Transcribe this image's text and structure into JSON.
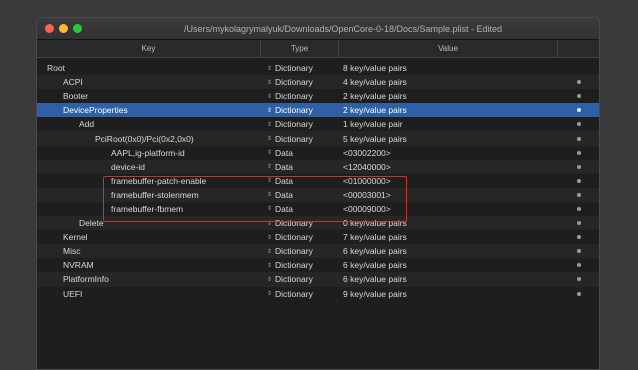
{
  "window": {
    "title": "/Users/mykolagrymalyuk/Downloads/OpenCore-0-18/Docs/Sample.plist - Edited"
  },
  "columns": {
    "key": "Key",
    "type": "Type",
    "value": "Value"
  },
  "rows": [
    {
      "key": "Root",
      "type": "Dictionary",
      "value": "8 key/value pairs"
    },
    {
      "key": "ACPI",
      "type": "Dictionary",
      "value": "4 key/value pairs"
    },
    {
      "key": "Booter",
      "type": "Dictionary",
      "value": "2 key/value pairs"
    },
    {
      "key": "DeviceProperties",
      "type": "Dictionary",
      "value": "2 key/value pairs"
    },
    {
      "key": "Add",
      "type": "Dictionary",
      "value": "1 key/value pair"
    },
    {
      "key": "PciRoot(0x0)/Pci(0x2,0x0)",
      "type": "Dictionary",
      "value": "5 key/value pairs"
    },
    {
      "key": "AAPL,ig-platform-id",
      "type": "Data",
      "value": "<03002200>"
    },
    {
      "key": "device-id",
      "type": "Data",
      "value": "<12040000>"
    },
    {
      "key": "framebuffer-patch-enable",
      "type": "Data",
      "value": "<01000000>"
    },
    {
      "key": "framebuffer-stolenmem",
      "type": "Data",
      "value": "<00003001>"
    },
    {
      "key": "framebuffer-fbmem",
      "type": "Data",
      "value": "<00009000>"
    },
    {
      "key": "Delete",
      "type": "Dictionary",
      "value": "0 key/value pairs"
    },
    {
      "key": "Kernel",
      "type": "Dictionary",
      "value": "7 key/value pairs"
    },
    {
      "key": "Misc",
      "type": "Dictionary",
      "value": "6 key/value pairs"
    },
    {
      "key": "NVRAM",
      "type": "Dictionary",
      "value": "6 key/value pairs"
    },
    {
      "key": "PlatformInfo",
      "type": "Dictionary",
      "value": "6 key/value pairs"
    },
    {
      "key": "UEFI",
      "type": "Dictionary",
      "value": "9 key/value pairs"
    }
  ],
  "selected_row": "DeviceProperties",
  "colors": {
    "selection": "#2f5fa5",
    "highlight_box": "#c0392b"
  },
  "icons": {
    "type_popup": "updown-chevron-icon",
    "row_action": "dot-icon"
  }
}
